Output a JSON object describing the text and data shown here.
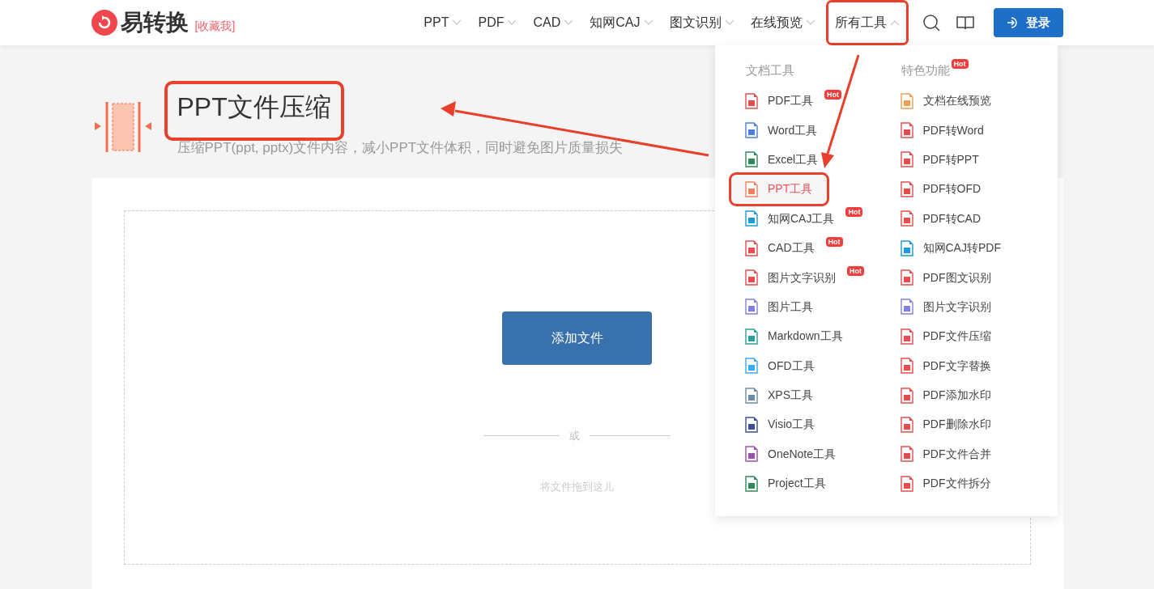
{
  "header": {
    "logo": "易转换",
    "bookmark": "[收藏我]",
    "nav": [
      {
        "label": "PPT",
        "expanded": false,
        "highlighted": false
      },
      {
        "label": "PDF",
        "expanded": false,
        "highlighted": false
      },
      {
        "label": "CAD",
        "expanded": false,
        "highlighted": false
      },
      {
        "label": "知网CAJ",
        "expanded": false,
        "highlighted": false
      },
      {
        "label": "图文识别",
        "expanded": false,
        "highlighted": false
      },
      {
        "label": "在线预览",
        "expanded": false,
        "highlighted": false
      },
      {
        "label": "所有工具",
        "expanded": true,
        "highlighted": true
      }
    ],
    "login": "登录"
  },
  "page": {
    "title": "PPT文件压缩",
    "title_highlighted": true,
    "subtitle": "压缩PPT(ppt, pptx)文件内容，减小PPT文件体积，同时避免图片质量损失"
  },
  "upload": {
    "button": "添加文件",
    "separator": "或",
    "hint": "将文件拖到这儿"
  },
  "menu": {
    "columns": [
      {
        "heading": "文档工具",
        "items": [
          {
            "label": "PDF工具",
            "badge": "Hot",
            "color": "#e84c4c",
            "selected": false,
            "highlighted": false
          },
          {
            "label": "Word工具",
            "color": "#4a7fe0",
            "selected": false,
            "highlighted": false
          },
          {
            "label": "Excel工具",
            "color": "#2e8b57",
            "selected": false,
            "highlighted": false
          },
          {
            "label": "PPT工具",
            "color": "#f08060",
            "selected": true,
            "highlighted": true
          },
          {
            "label": "知网CAJ工具",
            "badge": "Hot",
            "color": "#1a9ad6",
            "selected": false,
            "highlighted": false
          },
          {
            "label": "CAD工具",
            "badge": "Hot",
            "color": "#e84c4c",
            "selected": false,
            "highlighted": false
          },
          {
            "label": "图片文字识别",
            "badge": "Hot",
            "color": "#e84c4c",
            "selected": false,
            "highlighted": false
          },
          {
            "label": "图片工具",
            "color": "#8080e0",
            "selected": false,
            "highlighted": false
          },
          {
            "label": "Markdown工具",
            "color": "#2aa198",
            "selected": false,
            "highlighted": false
          },
          {
            "label": "OFD工具",
            "color": "#3aa9f0",
            "selected": false,
            "highlighted": false
          },
          {
            "label": "XPS工具",
            "color": "#6a8aa8",
            "selected": false,
            "highlighted": false
          },
          {
            "label": "Visio工具",
            "color": "#3a4fa0",
            "selected": false,
            "highlighted": false
          },
          {
            "label": "OneNote工具",
            "color": "#9b4fb0",
            "selected": false,
            "highlighted": false
          },
          {
            "label": "Project工具",
            "color": "#2e8b57",
            "selected": false,
            "highlighted": false
          }
        ]
      },
      {
        "heading": "特色功能",
        "badge": "Hot",
        "items": [
          {
            "label": "文档在线预览",
            "color": "#f0a050",
            "selected": false,
            "highlighted": false
          },
          {
            "label": "PDF转Word",
            "color": "#e84c4c",
            "selected": false,
            "highlighted": false
          },
          {
            "label": "PDF转PPT",
            "color": "#e84c4c",
            "selected": false,
            "highlighted": false
          },
          {
            "label": "PDF转OFD",
            "color": "#e84c4c",
            "selected": false,
            "highlighted": false
          },
          {
            "label": "PDF转CAD",
            "color": "#e84c4c",
            "selected": false,
            "highlighted": false
          },
          {
            "label": "知网CAJ转PDF",
            "color": "#1a9ad6",
            "selected": false,
            "highlighted": false
          },
          {
            "label": "PDF图文识别",
            "color": "#e84c4c",
            "selected": false,
            "highlighted": false
          },
          {
            "label": "图片文字识别",
            "color": "#8080e0",
            "selected": false,
            "highlighted": false
          },
          {
            "label": "PDF文件压缩",
            "color": "#e84c4c",
            "selected": false,
            "highlighted": false
          },
          {
            "label": "PDF文字替换",
            "color": "#e84c4c",
            "selected": false,
            "highlighted": false
          },
          {
            "label": "PDF添加水印",
            "color": "#e84c4c",
            "selected": false,
            "highlighted": false
          },
          {
            "label": "PDF删除水印",
            "color": "#e84c4c",
            "selected": false,
            "highlighted": false
          },
          {
            "label": "PDF文件合并",
            "color": "#e84c4c",
            "selected": false,
            "highlighted": false
          },
          {
            "label": "PDF文件拆分",
            "color": "#e84c4c",
            "selected": false,
            "highlighted": false
          }
        ]
      }
    ]
  }
}
